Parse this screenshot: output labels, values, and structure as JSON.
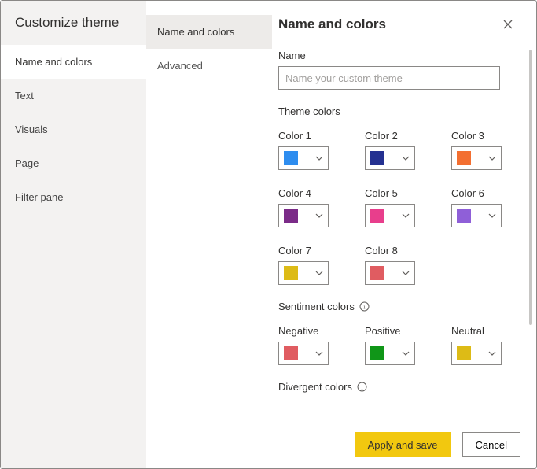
{
  "dialog_title": "Customize theme",
  "left_nav": {
    "items": [
      {
        "label": "Name and colors"
      },
      {
        "label": "Text"
      },
      {
        "label": "Visuals"
      },
      {
        "label": "Page"
      },
      {
        "label": "Filter pane"
      }
    ]
  },
  "sub_nav": {
    "items": [
      {
        "label": "Name and colors"
      },
      {
        "label": "Advanced"
      }
    ]
  },
  "header": {
    "title": "Name and colors"
  },
  "name_field": {
    "label": "Name",
    "value": "",
    "placeholder": "Name your custom theme"
  },
  "theme_colors": {
    "label": "Theme colors",
    "items": [
      {
        "label": "Color 1",
        "hex": "#2E8DEF"
      },
      {
        "label": "Color 2",
        "hex": "#243191"
      },
      {
        "label": "Color 3",
        "hex": "#F36F31"
      },
      {
        "label": "Color 4",
        "hex": "#7B2B88"
      },
      {
        "label": "Color 5",
        "hex": "#E83E8C"
      },
      {
        "label": "Color 6",
        "hex": "#8F5FD8"
      },
      {
        "label": "Color 7",
        "hex": "#DDBB16"
      },
      {
        "label": "Color 8",
        "hex": "#E05C61"
      }
    ]
  },
  "sentiment_colors": {
    "label": "Sentiment colors",
    "items": [
      {
        "label": "Negative",
        "hex": "#E05C61"
      },
      {
        "label": "Positive",
        "hex": "#109618"
      },
      {
        "label": "Neutral",
        "hex": "#DDBB16"
      }
    ]
  },
  "divergent": {
    "label": "Divergent colors"
  },
  "footer": {
    "apply_label": "Apply and save",
    "cancel_label": "Cancel"
  }
}
